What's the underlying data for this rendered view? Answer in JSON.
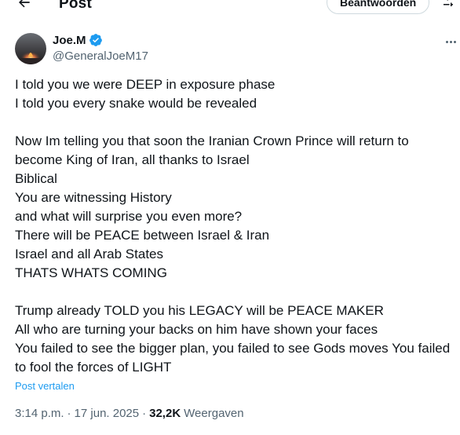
{
  "header": {
    "title": "Post",
    "reply_button_label": "Beantwoorden",
    "back_icon": "arrow-left-icon",
    "filter_icon": "sliders-icon"
  },
  "author": {
    "display_name": "Joe.M",
    "handle": "@GeneralJoeM17",
    "verified": true,
    "verified_color": "#1d9bf0"
  },
  "tweet": {
    "lines": [
      "I told you we were DEEP in exposure phase",
      "I told you every snake would be revealed",
      "",
      "Now Im telling you that soon the Iranian Crown Prince will return to",
      "become King of Iran, all thanks to Israel",
      "Biblical",
      "You are witnessing History",
      "and what will surprise you even more?",
      "There will be PEACE between Israel & Iran",
      "Israel and all Arab States",
      "THATS WHATS COMING",
      "",
      "Trump already TOLD you his LEGACY will be PEACE MAKER",
      "All who are turning your backs on him have shown your faces",
      "You failed to see the bigger plan, you failed to see Gods moves You failed",
      "to fool the forces of LIGHT"
    ],
    "translate_label": "Post vertalen"
  },
  "meta": {
    "time": "3:14 p.m.",
    "separator": "·",
    "date": "17 jun. 2025",
    "views_count": "32,2K",
    "views_label": "Weergaven"
  },
  "colors": {
    "text": "#0f1419",
    "secondary": "#536471",
    "accent": "#1d9bf0"
  }
}
